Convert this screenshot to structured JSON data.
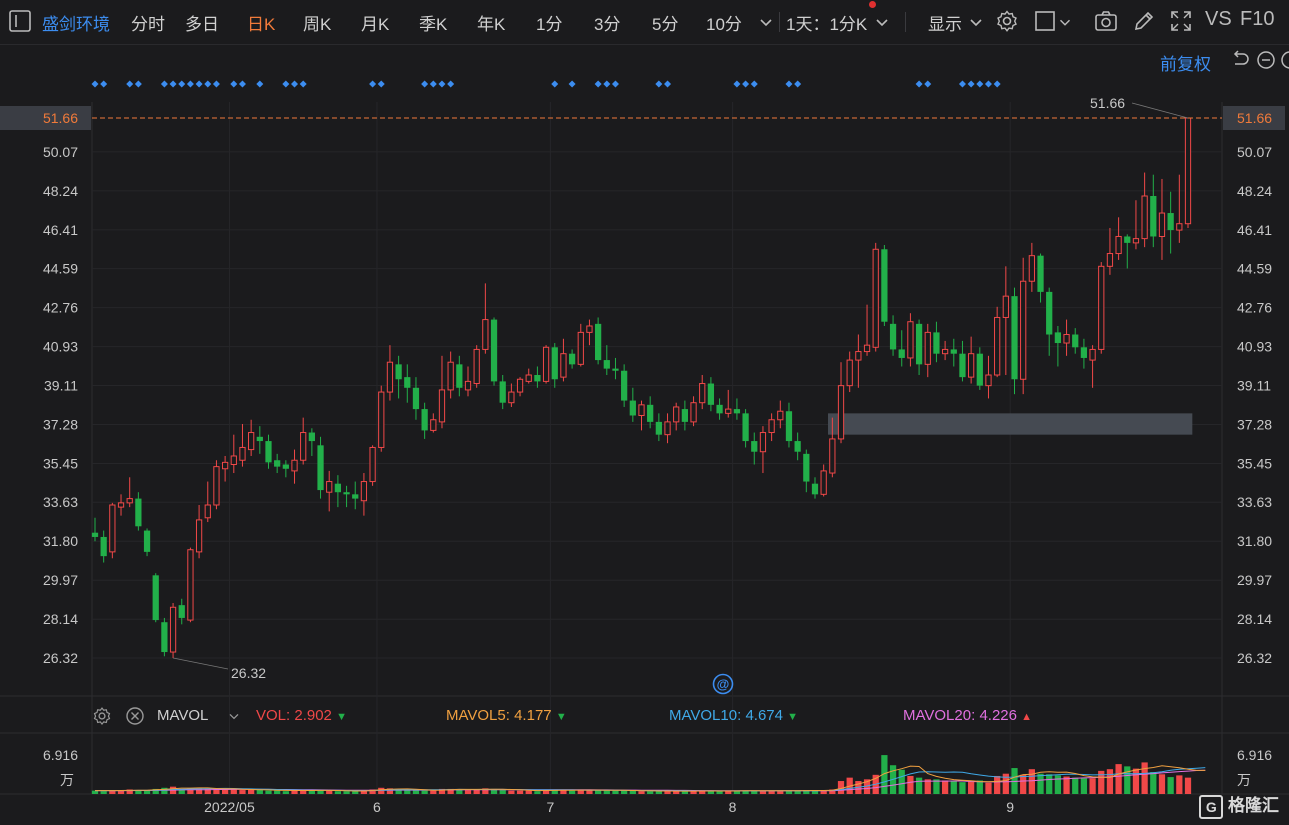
{
  "toolbar": {
    "stock_name": "盛剑环境",
    "periods": [
      "分时",
      "多日",
      "日K",
      "周K",
      "月K",
      "季K",
      "年K",
      "1分",
      "3分",
      "5分",
      "10分"
    ],
    "active_period": "日K",
    "interval_select": "1天：1分K",
    "display_label": "显示",
    "vs_label": "VS",
    "f10_label": "F10"
  },
  "adjust_label": "前复权",
  "price_axis": {
    "ticks": [
      "51.66",
      "50.07",
      "48.24",
      "46.41",
      "44.59",
      "42.76",
      "40.93",
      "39.11",
      "37.28",
      "35.45",
      "33.63",
      "31.80",
      "29.97",
      "28.14",
      "26.32"
    ],
    "current_price": "51.66",
    "high_label": "51.66",
    "low_label": "26.32"
  },
  "indicator": {
    "name": "MAVOL",
    "vol_label": "VOL:",
    "vol_value": "2.902",
    "mavol5_label": "MAVOL5:",
    "mavol5_value": "4.177",
    "mavol10_label": "MAVOL10:",
    "mavol10_value": "4.674",
    "mavol20_label": "MAVOL20:",
    "mavol20_value": "4.226",
    "colors": {
      "vol": "#f04848",
      "mavol5": "#f0a040",
      "mavol10": "#3fa9e8",
      "mavol20": "#e070e0"
    }
  },
  "volume_axis": {
    "max_label": "6.916",
    "unit": "万"
  },
  "date_axis": {
    "labels": [
      "2022/05",
      "6",
      "7",
      "8",
      "9"
    ]
  },
  "watermark": "格隆汇",
  "chart_data": {
    "type": "candlestick",
    "ylim": [
      26.32,
      51.66
    ],
    "volume_max": 6.916,
    "up_color": "#f04848",
    "down_color": "#22b04a",
    "candles": [
      [
        32.2,
        32.0,
        32.9,
        31.8,
        0.6
      ],
      [
        32.0,
        31.1,
        32.3,
        30.8,
        0.5
      ],
      [
        31.3,
        33.5,
        33.6,
        31.0,
        0.7
      ],
      [
        33.4,
        33.6,
        34.0,
        33.0,
        0.6
      ],
      [
        33.6,
        33.8,
        34.8,
        33.4,
        0.8
      ],
      [
        33.8,
        32.5,
        34.1,
        32.3,
        0.7
      ],
      [
        32.3,
        31.3,
        32.4,
        31.1,
        0.6
      ],
      [
        30.2,
        28.1,
        30.3,
        28.0,
        0.9
      ],
      [
        28.0,
        26.6,
        28.2,
        26.4,
        1.1
      ],
      [
        26.6,
        28.7,
        28.9,
        26.32,
        1.3
      ],
      [
        28.8,
        28.2,
        29.1,
        27.9,
        0.9
      ],
      [
        28.1,
        31.4,
        31.5,
        28.0,
        1.0
      ],
      [
        31.3,
        32.8,
        33.5,
        31.0,
        1.1
      ],
      [
        32.9,
        33.5,
        34.6,
        32.7,
        0.9
      ],
      [
        33.5,
        35.3,
        35.6,
        33.3,
        1.0
      ],
      [
        35.2,
        35.5,
        35.8,
        34.6,
        0.8
      ],
      [
        35.4,
        35.8,
        36.8,
        35.0,
        0.8
      ],
      [
        35.6,
        36.2,
        37.3,
        35.3,
        0.7
      ],
      [
        36.1,
        36.9,
        37.5,
        35.8,
        0.8
      ],
      [
        36.7,
        36.5,
        37.2,
        35.9,
        0.7
      ],
      [
        36.5,
        35.5,
        36.8,
        35.2,
        0.6
      ],
      [
        35.6,
        35.3,
        35.9,
        35.0,
        0.6
      ],
      [
        35.4,
        35.2,
        35.6,
        34.8,
        0.5
      ],
      [
        35.1,
        35.6,
        36.1,
        34.5,
        0.6
      ],
      [
        35.6,
        36.9,
        37.6,
        35.4,
        0.7
      ],
      [
        36.9,
        36.5,
        37.1,
        35.8,
        0.6
      ],
      [
        36.3,
        34.2,
        36.7,
        33.8,
        0.7
      ],
      [
        34.1,
        34.6,
        35.1,
        33.2,
        0.6
      ],
      [
        34.5,
        34.1,
        34.9,
        33.4,
        0.5
      ],
      [
        34.1,
        34.0,
        34.4,
        33.4,
        0.5
      ],
      [
        34.0,
        33.8,
        34.6,
        33.3,
        0.5
      ],
      [
        33.7,
        34.6,
        35.0,
        33.0,
        0.6
      ],
      [
        34.6,
        36.2,
        36.3,
        34.4,
        0.8
      ],
      [
        36.2,
        38.8,
        39.1,
        36.0,
        1.1
      ],
      [
        38.8,
        40.2,
        41.0,
        38.4,
        1.0
      ],
      [
        40.1,
        39.4,
        40.5,
        38.5,
        0.8
      ],
      [
        39.5,
        39.0,
        40.1,
        38.3,
        0.7
      ],
      [
        39.0,
        38.0,
        39.5,
        37.5,
        0.7
      ],
      [
        38.0,
        37.0,
        38.3,
        36.6,
        0.6
      ],
      [
        37.0,
        37.5,
        37.8,
        36.9,
        0.6
      ],
      [
        37.4,
        38.9,
        40.5,
        37.1,
        0.9
      ],
      [
        38.9,
        40.2,
        40.7,
        38.5,
        0.9
      ],
      [
        40.1,
        39.0,
        40.5,
        38.6,
        0.8
      ],
      [
        38.9,
        39.3,
        40.0,
        38.6,
        0.7
      ],
      [
        39.2,
        40.8,
        41.0,
        39.0,
        0.8
      ],
      [
        40.8,
        42.2,
        43.9,
        40.6,
        1.0
      ],
      [
        42.2,
        39.3,
        42.3,
        39.1,
        0.9
      ],
      [
        39.3,
        38.3,
        39.6,
        38.0,
        0.7
      ],
      [
        38.3,
        38.8,
        39.2,
        38.1,
        0.6
      ],
      [
        38.8,
        39.4,
        39.5,
        38.6,
        0.6
      ],
      [
        39.3,
        39.6,
        39.9,
        39.2,
        0.6
      ],
      [
        39.6,
        39.3,
        40.0,
        39.0,
        0.5
      ],
      [
        39.3,
        40.9,
        41.0,
        39.2,
        0.7
      ],
      [
        40.9,
        39.4,
        41.1,
        39.0,
        0.7
      ],
      [
        39.5,
        40.6,
        41.3,
        39.3,
        0.7
      ],
      [
        40.6,
        40.1,
        40.8,
        39.9,
        0.6
      ],
      [
        40.1,
        41.6,
        42.0,
        40.0,
        0.8
      ],
      [
        41.6,
        41.9,
        42.2,
        41.0,
        0.7
      ],
      [
        42.0,
        40.3,
        42.3,
        40.1,
        0.7
      ],
      [
        40.3,
        39.9,
        41.0,
        39.6,
        0.6
      ],
      [
        39.9,
        39.8,
        40.4,
        39.4,
        0.6
      ],
      [
        39.8,
        38.4,
        40.1,
        38.1,
        0.6
      ],
      [
        38.4,
        37.7,
        39.0,
        37.4,
        0.6
      ],
      [
        37.7,
        38.2,
        38.4,
        37.0,
        0.5
      ],
      [
        38.2,
        37.4,
        38.6,
        37.1,
        0.5
      ],
      [
        37.4,
        36.8,
        37.8,
        36.5,
        0.6
      ],
      [
        36.8,
        37.4,
        37.8,
        36.4,
        0.5
      ],
      [
        37.4,
        38.1,
        38.3,
        37.0,
        0.5
      ],
      [
        38.0,
        37.4,
        38.4,
        37.0,
        0.5
      ],
      [
        37.4,
        38.3,
        38.6,
        37.2,
        0.5
      ],
      [
        38.3,
        39.2,
        39.6,
        38.0,
        0.6
      ],
      [
        39.2,
        38.2,
        39.5,
        37.9,
        0.6
      ],
      [
        38.2,
        37.8,
        38.5,
        37.5,
        0.5
      ],
      [
        37.8,
        38.0,
        38.9,
        37.6,
        0.5
      ],
      [
        38.0,
        37.8,
        38.5,
        37.5,
        0.5
      ],
      [
        37.8,
        36.5,
        38.0,
        36.2,
        0.6
      ],
      [
        36.5,
        36.0,
        36.9,
        35.4,
        0.6
      ],
      [
        36.0,
        36.9,
        37.2,
        35.0,
        0.6
      ],
      [
        36.9,
        37.5,
        37.8,
        36.5,
        0.6
      ],
      [
        37.5,
        37.9,
        38.4,
        37.1,
        0.5
      ],
      [
        37.9,
        36.5,
        38.3,
        36.2,
        0.6
      ],
      [
        36.5,
        36.0,
        36.9,
        35.6,
        0.6
      ],
      [
        35.9,
        34.6,
        36.1,
        34.1,
        0.7
      ],
      [
        34.5,
        34.0,
        34.8,
        33.8,
        0.6
      ],
      [
        34.0,
        35.1,
        35.4,
        33.9,
        0.6
      ],
      [
        35.0,
        36.6,
        37.6,
        34.8,
        0.8
      ],
      [
        36.6,
        39.1,
        40.2,
        36.4,
        2.3
      ],
      [
        39.1,
        40.3,
        40.7,
        38.8,
        2.9
      ],
      [
        40.3,
        40.7,
        41.5,
        39.0,
        2.3
      ],
      [
        40.7,
        41.0,
        42.9,
        40.5,
        2.6
      ],
      [
        40.9,
        45.5,
        45.8,
        40.7,
        3.4
      ],
      [
        45.5,
        42.1,
        45.7,
        41.9,
        6.9
      ],
      [
        42.0,
        40.8,
        42.4,
        40.5,
        5.1
      ],
      [
        40.8,
        40.4,
        41.7,
        40.0,
        4.3
      ],
      [
        40.4,
        42.1,
        42.5,
        40.0,
        3.2
      ],
      [
        42.0,
        40.1,
        42.2,
        39.6,
        2.9
      ],
      [
        40.1,
        41.6,
        42.0,
        39.5,
        2.6
      ],
      [
        41.6,
        40.6,
        42.1,
        40.2,
        2.6
      ],
      [
        40.6,
        40.8,
        41.2,
        40.3,
        2.4
      ],
      [
        40.8,
        40.6,
        41.3,
        40.0,
        2.3
      ],
      [
        40.6,
        39.5,
        41.2,
        39.3,
        2.1
      ],
      [
        39.5,
        40.6,
        41.4,
        39.2,
        2.2
      ],
      [
        40.6,
        39.1,
        40.9,
        38.9,
        2.4
      ],
      [
        39.1,
        39.6,
        40.5,
        38.5,
        2.0
      ],
      [
        39.6,
        42.3,
        42.8,
        39.5,
        3.2
      ],
      [
        42.3,
        43.3,
        44.7,
        39.6,
        3.6
      ],
      [
        43.3,
        39.4,
        43.7,
        38.7,
        4.6
      ],
      [
        39.4,
        44.0,
        45.1,
        38.7,
        3.4
      ],
      [
        44.0,
        45.2,
        45.8,
        43.5,
        4.4
      ],
      [
        45.2,
        43.5,
        45.3,
        43.0,
        3.6
      ],
      [
        43.5,
        41.5,
        43.7,
        40.5,
        3.5
      ],
      [
        41.6,
        41.1,
        41.9,
        40.0,
        3.3
      ],
      [
        41.1,
        41.5,
        42.2,
        40.5,
        3.1
      ],
      [
        41.5,
        40.9,
        41.8,
        40.6,
        2.9
      ],
      [
        40.9,
        40.4,
        41.3,
        39.9,
        2.8
      ],
      [
        40.3,
        40.8,
        41.0,
        39.0,
        2.8
      ],
      [
        40.8,
        44.7,
        44.9,
        40.6,
        4.1
      ],
      [
        44.7,
        45.3,
        46.5,
        44.3,
        4.4
      ],
      [
        45.3,
        46.1,
        47.0,
        45.0,
        5.3
      ],
      [
        46.1,
        45.8,
        46.2,
        44.6,
        4.9
      ],
      [
        45.8,
        46.0,
        47.8,
        45.5,
        4.5
      ],
      [
        46.0,
        48.0,
        49.1,
        45.6,
        5.6
      ],
      [
        48.0,
        46.1,
        49.0,
        45.6,
        3.9
      ],
      [
        46.1,
        47.2,
        48.8,
        45.0,
        3.5
      ],
      [
        47.2,
        46.4,
        48.2,
        45.3,
        3.0
      ],
      [
        46.4,
        46.7,
        49.0,
        45.8,
        3.3
      ],
      [
        46.7,
        51.66,
        51.66,
        46.5,
        2.902
      ]
    ],
    "mavol5": [
      0.6,
      0.6,
      0.6,
      0.62,
      0.64,
      0.66,
      0.68,
      0.74,
      0.82,
      0.92,
      1.04,
      1.04,
      1.08,
      1.08,
      0.98,
      0.94,
      0.92,
      0.84,
      0.8,
      0.76,
      0.72,
      0.68,
      0.64,
      0.62,
      0.62,
      0.62,
      0.64,
      0.64,
      0.62,
      0.58,
      0.54,
      0.54,
      0.62,
      0.74,
      0.84,
      0.88,
      0.9,
      0.86,
      0.76,
      0.68,
      0.7,
      0.76,
      0.82,
      0.82,
      0.82,
      0.84,
      0.86,
      0.84,
      0.8,
      0.76,
      0.68,
      0.6,
      0.62,
      0.64,
      0.66,
      0.66,
      0.7,
      0.7,
      0.7,
      0.68,
      0.68,
      0.66,
      0.62,
      0.58,
      0.56,
      0.54,
      0.54,
      0.52,
      0.52,
      0.52,
      0.54,
      0.54,
      0.54,
      0.54,
      0.54,
      0.56,
      0.56,
      0.56,
      0.58,
      0.58,
      0.58,
      0.58,
      0.6,
      0.62,
      0.62,
      0.66,
      0.98,
      1.4,
      1.78,
      2.18,
      2.76,
      3.62,
      4.12,
      4.48,
      4.94,
      4.88,
      3.62,
      3.12,
      2.78,
      2.56,
      2.44,
      2.34,
      2.22,
      2.16,
      2.24,
      2.38,
      2.98,
      3.44,
      3.52,
      3.84,
      3.94,
      3.84,
      3.88,
      3.64,
      3.26,
      3.04,
      2.96,
      2.92,
      3.54,
      3.92,
      4.26,
      4.5,
      4.7,
      5.0,
      4.84,
      4.66,
      4.38,
      4.18,
      4.177
    ],
    "mavol10": [
      0.6,
      0.6,
      0.6,
      0.61,
      0.62,
      0.63,
      0.64,
      0.67,
      0.72,
      0.79,
      0.85,
      0.88,
      0.91,
      0.95,
      0.98,
      0.99,
      0.97,
      0.94,
      0.9,
      0.87,
      0.84,
      0.8,
      0.76,
      0.72,
      0.69,
      0.67,
      0.66,
      0.64,
      0.63,
      0.62,
      0.6,
      0.59,
      0.61,
      0.66,
      0.71,
      0.74,
      0.76,
      0.76,
      0.74,
      0.74,
      0.77,
      0.8,
      0.81,
      0.8,
      0.79,
      0.8,
      0.82,
      0.82,
      0.8,
      0.78,
      0.76,
      0.73,
      0.72,
      0.72,
      0.73,
      0.72,
      0.7,
      0.68,
      0.67,
      0.66,
      0.65,
      0.63,
      0.62,
      0.61,
      0.6,
      0.59,
      0.58,
      0.57,
      0.56,
      0.55,
      0.55,
      0.55,
      0.55,
      0.55,
      0.55,
      0.55,
      0.55,
      0.55,
      0.56,
      0.56,
      0.57,
      0.57,
      0.58,
      0.59,
      0.6,
      0.63,
      0.78,
      1.0,
      1.2,
      1.41,
      1.73,
      2.14,
      2.6,
      3.08,
      3.57,
      3.91,
      3.93,
      3.9,
      3.87,
      3.91,
      3.86,
      3.58,
      3.37,
      3.18,
      3.03,
      2.96,
      3.0,
      3.1,
      3.16,
      3.26,
      3.34,
      3.41,
      3.5,
      3.49,
      3.45,
      3.39,
      3.4,
      3.44,
      3.59,
      3.62,
      3.58,
      3.66,
      3.77,
      3.95,
      4.2,
      4.38,
      4.46,
      4.58,
      4.674
    ],
    "mavol20": [
      0.6,
      0.6,
      0.6,
      0.6,
      0.61,
      0.62,
      0.62,
      0.64,
      0.66,
      0.69,
      0.72,
      0.74,
      0.76,
      0.77,
      0.79,
      0.8,
      0.81,
      0.81,
      0.81,
      0.81,
      0.81,
      0.8,
      0.79,
      0.78,
      0.77,
      0.75,
      0.73,
      0.71,
      0.69,
      0.68,
      0.67,
      0.66,
      0.66,
      0.67,
      0.68,
      0.69,
      0.7,
      0.7,
      0.7,
      0.7,
      0.71,
      0.72,
      0.73,
      0.74,
      0.75,
      0.76,
      0.77,
      0.77,
      0.77,
      0.76,
      0.76,
      0.76,
      0.76,
      0.75,
      0.75,
      0.75,
      0.74,
      0.74,
      0.73,
      0.72,
      0.71,
      0.7,
      0.69,
      0.68,
      0.67,
      0.66,
      0.65,
      0.64,
      0.63,
      0.62,
      0.61,
      0.6,
      0.59,
      0.59,
      0.58,
      0.58,
      0.58,
      0.57,
      0.57,
      0.57,
      0.57,
      0.57,
      0.58,
      0.58,
      0.58,
      0.59,
      0.66,
      0.78,
      0.88,
      0.98,
      1.14,
      1.35,
      1.58,
      1.82,
      2.07,
      2.25,
      2.29,
      2.29,
      2.28,
      2.31,
      2.31,
      2.22,
      2.17,
      2.14,
      2.14,
      2.16,
      2.22,
      2.3,
      2.36,
      2.46,
      2.58,
      2.66,
      2.72,
      2.78,
      2.86,
      2.9,
      2.96,
      3.04,
      3.16,
      3.28,
      3.4,
      3.52,
      3.62,
      3.74,
      3.86,
      3.98,
      4.06,
      4.16,
      4.226
    ],
    "x_date_labels": [
      {
        "label": "2022/05",
        "index": 16
      },
      {
        "label": "6",
        "index": 33
      },
      {
        "label": "7",
        "index": 53
      },
      {
        "label": "8",
        "index": 74
      },
      {
        "label": "9",
        "index": 106
      }
    ],
    "highlight_zone": {
      "from_index": 85,
      "to_index": 126,
      "y_low": 36.8,
      "y_high": 37.8
    }
  }
}
